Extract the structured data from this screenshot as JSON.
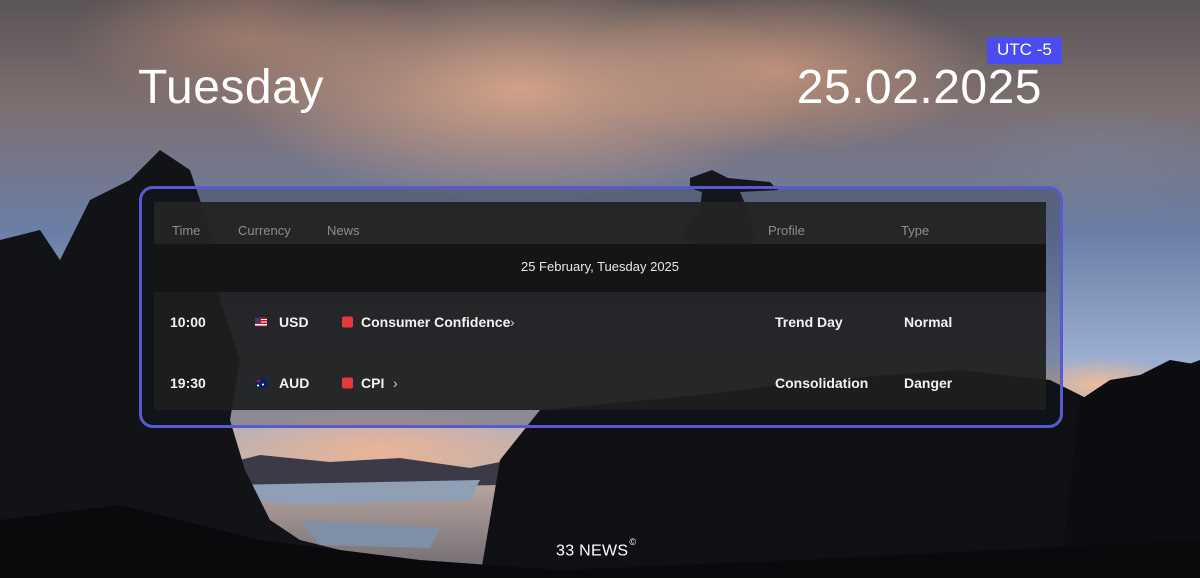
{
  "header": {
    "day": "Tuesday",
    "date": "25.02.2025",
    "timezone": "UTC -5"
  },
  "table": {
    "columns": {
      "time": "Time",
      "currency": "Currency",
      "news": "News",
      "profile": "Profile",
      "type": "Type"
    },
    "day_label": "25 February, Tuesday 2025",
    "rows": [
      {
        "time": "10:00",
        "flag": "us-flag-icon",
        "currency": "USD",
        "impact_color": "#e5393b",
        "news": "Consumer Confidence",
        "profile": "Trend Day",
        "type": "Normal"
      },
      {
        "time": "19:30",
        "flag": "au-flag-icon",
        "currency": "AUD",
        "impact_color": "#e5393b",
        "news": "CPI",
        "profile": "Consolidation",
        "type": "Danger"
      }
    ]
  },
  "footer": {
    "brand": "33 NEWS",
    "mark": "©"
  },
  "colors": {
    "accent": "#4b4bf2",
    "frame": "#5a5ad0",
    "impact_high": "#e5393b"
  }
}
